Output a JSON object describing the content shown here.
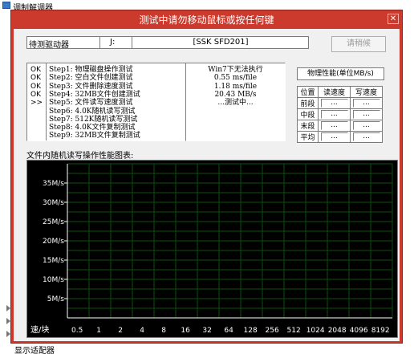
{
  "background": {
    "top_item": "调制解调器",
    "bottom_item": "显示适配器"
  },
  "dialog": {
    "title": "测试中请勿移动鼠标或按任何键",
    "close_icon": "close-icon",
    "title_color": "#cc3a2d"
  },
  "drive": {
    "label": "待测驱动器",
    "letter": "J:",
    "model": "[SSK SFD201]"
  },
  "cancel_button": "请稍候",
  "steps": [
    {
      "status": "OK",
      "name": "Step1: 物理磁盘操作测试"
    },
    {
      "status": "OK",
      "name": "Step2: 空白文件创建测试"
    },
    {
      "status": "OK",
      "name": "Step3: 文件删除速度测试"
    },
    {
      "status": "OK",
      "name": "Step4: 32MB文件创建测试"
    },
    {
      "status": ">>",
      "name": "Step5: 文件读写速度测试"
    },
    {
      "status": "",
      "name": "Step6: 4.0K随机读写测试"
    },
    {
      "status": "",
      "name": "Step7: 512K随机读写测试"
    },
    {
      "status": "",
      "name": "Step8: 4.0K文件复制测试"
    },
    {
      "status": "",
      "name": "Step9: 32MB文件复制测试"
    }
  ],
  "results": [
    "Win7下无法执行",
    "0.55 ms/file",
    "1.18 ms/file",
    "20.43 MB/s",
    "...测试中..."
  ],
  "perf": {
    "title": "物理性能(单位MB/s)",
    "headers": [
      "位置",
      "读速度",
      "写速度"
    ],
    "rows": [
      {
        "label": "前段",
        "read": "...",
        "write": "..."
      },
      {
        "label": "中段",
        "read": "...",
        "write": "..."
      },
      {
        "label": "末段",
        "read": "...",
        "write": "..."
      },
      {
        "label": "平均",
        "read": "...",
        "write": "..."
      }
    ]
  },
  "chart_data": {
    "type": "line",
    "title": "文件内随机读写操作性能图表:",
    "ylabel_ticks": [
      "35M/s",
      "30M/s",
      "25M/s",
      "20M/s",
      "15M/s",
      "10M/s",
      "5M/s"
    ],
    "y_values": [
      35,
      30,
      25,
      20,
      15,
      10,
      5
    ],
    "ylim": [
      0,
      40
    ],
    "xaxis_title": "速/块",
    "categories": [
      "0.5",
      "1",
      "2",
      "4",
      "8",
      "16",
      "32",
      "64",
      "128",
      "256",
      "512",
      "1024",
      "2048",
      "4096",
      "8192"
    ],
    "grid": true,
    "series": [],
    "background_color": "#000000",
    "grid_color": "#0b4f0b",
    "axis_color": "#ffffff"
  }
}
